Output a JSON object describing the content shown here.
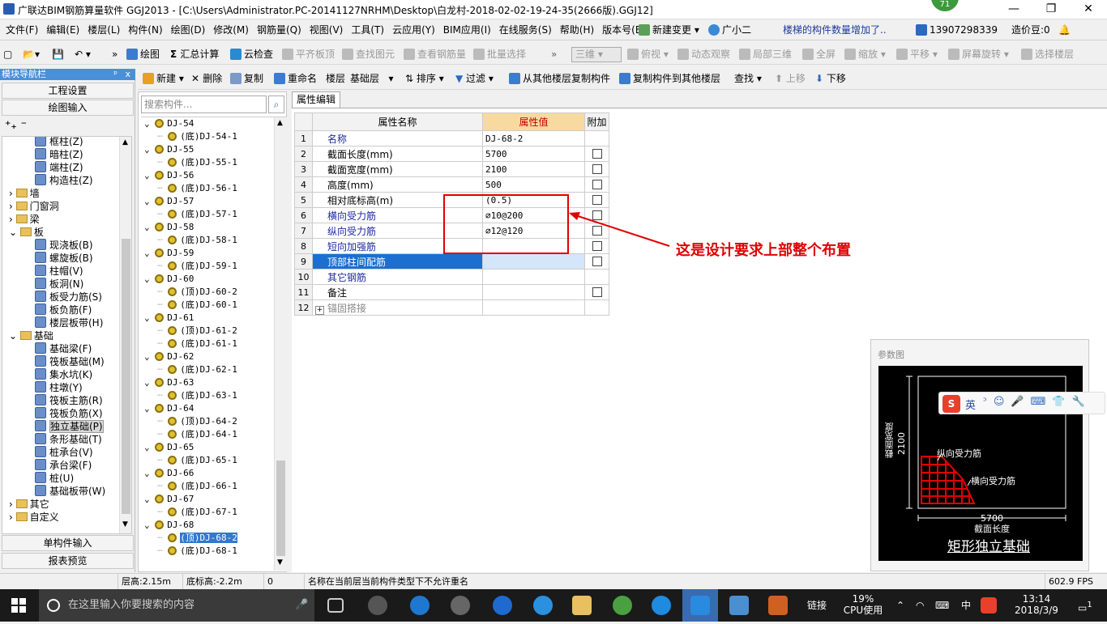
{
  "titlebar": {
    "title": "广联达BIM钢筋算量软件 GGJ2013 - [C:\\Users\\Administrator.PC-20141127NRHM\\Desktop\\白龙村-2018-02-02-19-24-35(2666版).GGJ12]",
    "badge": "71",
    "minimize": "—",
    "restore": "❐",
    "close": "✕"
  },
  "menubar": {
    "items": [
      "文件(F)",
      "编辑(E)",
      "楼层(L)",
      "构件(N)",
      "绘图(D)",
      "修改(M)",
      "钢筋量(Q)",
      "视图(V)",
      "工具(T)",
      "云应用(Y)",
      "BIM应用(I)",
      "在线服务(S)",
      "帮助(H)",
      "版本号(B)"
    ],
    "new_change": "新建变更",
    "assistant": "广小二",
    "notice": "楼梯的构件数量增加了..",
    "phone": "13907298339",
    "price_bean": "造价豆:0"
  },
  "toolbar1": {
    "draw": "绘图",
    "sum": "汇总计算",
    "cloud_check": "云检查",
    "flush_slab": "平齐板顶",
    "find_element": "查找图元",
    "view_rebar": "查看钢筋量",
    "batch_select": "批量选择",
    "view_3d": "三维",
    "top_view": "俯视",
    "dynamic_view": "动态观察",
    "local_3d": "局部三维",
    "fullscreen": "全屏",
    "zoom": "缩放",
    "pan": "平移",
    "rotate": "屏幕旋转",
    "select_floor": "选择楼层"
  },
  "toolbar2": {
    "new": "新建",
    "delete": "删除",
    "copy": "复制",
    "rename": "重命名",
    "floor_label": "楼层",
    "floor_value": "基础层",
    "sort": "排序",
    "filter": "过滤",
    "copy_from_floor": "从其他楼层复制构件",
    "copy_to_floor": "复制构件到其他楼层",
    "find": "查找",
    "move_up": "上移",
    "move_down": "下移"
  },
  "nav": {
    "header": "模块导航栏",
    "pin": "ᵖ",
    "close": "x",
    "project_settings": "工程设置",
    "drawing_input": "绘图输入",
    "single_input": "单构件输入",
    "report_preview": "报表预览",
    "tree": [
      {
        "label": "框柱(Z)",
        "level": 2
      },
      {
        "label": "暗柱(Z)",
        "level": 2
      },
      {
        "label": "端柱(Z)",
        "level": 2
      },
      {
        "label": "构造柱(Z)",
        "level": 2
      },
      {
        "label": "墙",
        "level": 1,
        "folder": true,
        "expand": "›"
      },
      {
        "label": "门窗洞",
        "level": 1,
        "folder": true,
        "expand": "›"
      },
      {
        "label": "梁",
        "level": 1,
        "folder": true,
        "expand": "›"
      },
      {
        "label": "板",
        "level": 1,
        "folder": true,
        "expand": "⌄"
      },
      {
        "label": "现浇板(B)",
        "level": 2
      },
      {
        "label": "螺旋板(B)",
        "level": 2
      },
      {
        "label": "柱帽(V)",
        "level": 2
      },
      {
        "label": "板洞(N)",
        "level": 2
      },
      {
        "label": "板受力筋(S)",
        "level": 2
      },
      {
        "label": "板负筋(F)",
        "level": 2
      },
      {
        "label": "楼层板带(H)",
        "level": 2
      },
      {
        "label": "基础",
        "level": 1,
        "folder": true,
        "expand": "⌄"
      },
      {
        "label": "基础梁(F)",
        "level": 2
      },
      {
        "label": "筏板基础(M)",
        "level": 2
      },
      {
        "label": "集水坑(K)",
        "level": 2
      },
      {
        "label": "柱墩(Y)",
        "level": 2
      },
      {
        "label": "筏板主筋(R)",
        "level": 2
      },
      {
        "label": "筏板负筋(X)",
        "level": 2
      },
      {
        "label": "独立基础(P)",
        "level": 2,
        "selected": true
      },
      {
        "label": "条形基础(T)",
        "level": 2
      },
      {
        "label": "桩承台(V)",
        "level": 2
      },
      {
        "label": "承台梁(F)",
        "level": 2
      },
      {
        "label": "桩(U)",
        "level": 2
      },
      {
        "label": "基础板带(W)",
        "level": 2
      },
      {
        "label": "其它",
        "level": 1,
        "folder": true,
        "expand": "›"
      },
      {
        "label": "自定义",
        "level": 1,
        "folder": true,
        "expand": "›"
      }
    ]
  },
  "list": {
    "search_placeholder": "搜索构件...",
    "items": [
      {
        "label": "DJ-54",
        "level": 0
      },
      {
        "label": "(底)DJ-54-1",
        "level": 1
      },
      {
        "label": "DJ-55",
        "level": 0
      },
      {
        "label": "(底)DJ-55-1",
        "level": 1
      },
      {
        "label": "DJ-56",
        "level": 0
      },
      {
        "label": "(底)DJ-56-1",
        "level": 1
      },
      {
        "label": "DJ-57",
        "level": 0
      },
      {
        "label": "(底)DJ-57-1",
        "level": 1
      },
      {
        "label": "DJ-58",
        "level": 0
      },
      {
        "label": "(底)DJ-58-1",
        "level": 1
      },
      {
        "label": "DJ-59",
        "level": 0
      },
      {
        "label": "(底)DJ-59-1",
        "level": 1
      },
      {
        "label": "DJ-60",
        "level": 0
      },
      {
        "label": "(顶)DJ-60-2",
        "level": 1
      },
      {
        "label": "(底)DJ-60-1",
        "level": 1
      },
      {
        "label": "DJ-61",
        "level": 0
      },
      {
        "label": "(顶)DJ-61-2",
        "level": 1
      },
      {
        "label": "(底)DJ-61-1",
        "level": 1
      },
      {
        "label": "DJ-62",
        "level": 0
      },
      {
        "label": "(底)DJ-62-1",
        "level": 1
      },
      {
        "label": "DJ-63",
        "level": 0
      },
      {
        "label": "(底)DJ-63-1",
        "level": 1
      },
      {
        "label": "DJ-64",
        "level": 0
      },
      {
        "label": "(顶)DJ-64-2",
        "level": 1
      },
      {
        "label": "(底)DJ-64-1",
        "level": 1
      },
      {
        "label": "DJ-65",
        "level": 0
      },
      {
        "label": "(底)DJ-65-1",
        "level": 1
      },
      {
        "label": "DJ-66",
        "level": 0
      },
      {
        "label": "(底)DJ-66-1",
        "level": 1
      },
      {
        "label": "DJ-67",
        "level": 0
      },
      {
        "label": "(底)DJ-67-1",
        "level": 1
      },
      {
        "label": "DJ-68",
        "level": 0
      },
      {
        "label": "(顶)DJ-68-2",
        "level": 1,
        "selected": true
      },
      {
        "label": "(底)DJ-68-1",
        "level": 1
      }
    ]
  },
  "props": {
    "tab": "属性编辑",
    "col_name": "属性名称",
    "col_value": "属性值",
    "col_extra": "附加",
    "rows": [
      {
        "no": "1",
        "name": "名称",
        "value": "DJ-68-2",
        "blue": true,
        "check": false
      },
      {
        "no": "2",
        "name": "截面长度(mm)",
        "value": "5700",
        "blue": false,
        "check": true
      },
      {
        "no": "3",
        "name": "截面宽度(mm)",
        "value": "2100",
        "blue": false,
        "check": true
      },
      {
        "no": "4",
        "name": "高度(mm)",
        "value": "500",
        "blue": false,
        "check": true
      },
      {
        "no": "5",
        "name": "相对底标高(m)",
        "value": "(0.5)",
        "blue": false,
        "check": true
      },
      {
        "no": "6",
        "name": "横向受力筋",
        "value": "⌀10@200",
        "blue": true,
        "check": true
      },
      {
        "no": "7",
        "name": "纵向受力筋",
        "value": "⌀12@120",
        "blue": true,
        "check": true
      },
      {
        "no": "8",
        "name": "短向加强筋",
        "value": "",
        "blue": true,
        "check": true
      },
      {
        "no": "9",
        "name": "顶部柱间配筋",
        "value": "",
        "blue": true,
        "check": true,
        "selected": true
      },
      {
        "no": "10",
        "name": "其它钢筋",
        "value": "",
        "blue": true,
        "check": false
      },
      {
        "no": "11",
        "name": "备注",
        "value": "",
        "blue": false,
        "check": true
      },
      {
        "no": "12",
        "name": "锚固搭接",
        "value": "",
        "blue": false,
        "check": false,
        "gray": true,
        "expand": "+"
      }
    ]
  },
  "annotation": "这是设计要求上部整个布置",
  "param": {
    "title": "参数图",
    "width_label": "截面宽度",
    "width_value": "2100",
    "long_bar": "纵向受力筋",
    "trans_bar": "横向受力筋",
    "length_value": "5700",
    "length_label": "截面长度",
    "caption": "矩形独立基础"
  },
  "ime": {
    "lang": "英",
    "items": [
      "ᵓ",
      "☺",
      "🎤",
      "⌨",
      "👕",
      "🔧"
    ]
  },
  "status": {
    "floor_height": "层高:2.15m",
    "bottom_elev": "底标高:-2.2m",
    "zero": "0",
    "message": "名称在当前层当前构件类型下不允许重名",
    "fps": "602.9 FPS"
  },
  "taskbar": {
    "search_placeholder": "在这里输入你要搜索的内容",
    "link": "链接",
    "cpu_pct": "19%",
    "cpu_label": "CPU使用",
    "ime": "中",
    "time": "13:14",
    "date": "2018/3/9",
    "notif_count": "1"
  },
  "colors": {
    "accent": "#3278d0",
    "annotation": "#e00000",
    "rebar": "#e00000"
  }
}
